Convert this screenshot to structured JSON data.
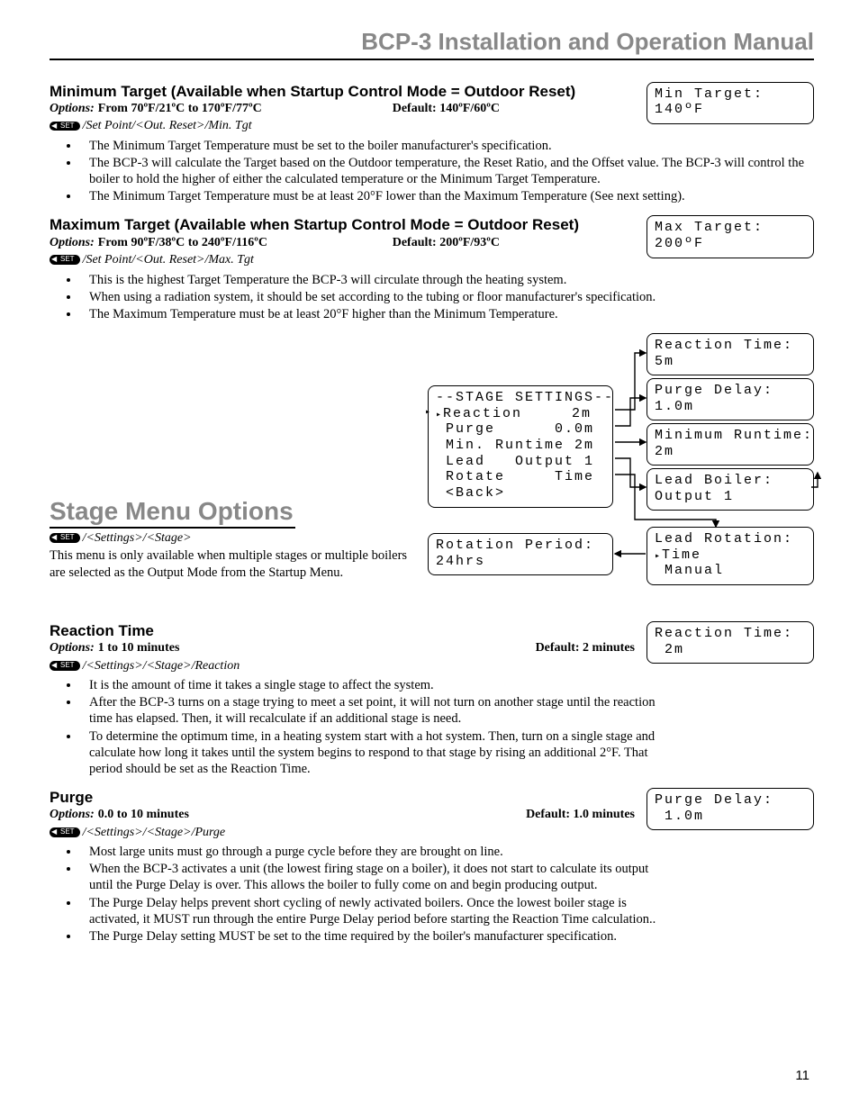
{
  "doc_title": "BCP-3 Installation and Operation Manual",
  "page_number": "11",
  "set_btn_label": "SET",
  "min_target_section": {
    "heading": "Minimum Target (Available when Startup Control Mode = Outdoor Reset)",
    "options_label": "Options:",
    "options_range": "From 70ºF/21ºC to 170ºF/77ºC",
    "default": "Default: 140ºF/60ºC",
    "path": "/Set Point/<Out. Reset>/Min. Tgt",
    "bullets": [
      "The Minimum Target Temperature must be set to the boiler manufacturer's specification.",
      "The BCP-3 will calculate the Target based on the Outdoor temperature, the Reset Ratio, and the Offset value.  The BCP-3 will control the boiler to hold the higher of either the calculated temperature or the Minimum Target Temperature.",
      "The Minimum Target Temperature must be at least 20°F lower than the Maximum Temperature (See next setting)."
    ],
    "lcd": {
      "l1": "Min Target:",
      "l2": "140ºF"
    }
  },
  "max_target_section": {
    "heading": "Maximum Target (Available when Startup Control Mode = Outdoor Reset)",
    "options_label": "Options:",
    "options_range": "From 90ºF/38ºC to 240ºF/116ºC",
    "default": "Default: 200ºF/93ºC",
    "path": "/Set Point/<Out. Reset>/Max. Tgt",
    "bullets": [
      "This is the highest Target Temperature the BCP-3 will circulate through the heating system.",
      "When using a radiation system, it should be set according to the tubing or floor manufacturer's specification.",
      "The Maximum Temperature must be at least 20°F higher than the Minimum Temperature."
    ],
    "lcd": {
      "l1": "Max Target:",
      "l2": "200ºF"
    }
  },
  "stage_menu": {
    "heading": "Stage Menu Options",
    "path": "/<Settings>/<Stage>",
    "intro": "This menu is only available when multiple stages or multiple boilers are selected as the Output Mode from the Startup Menu.",
    "settings_lcd": {
      "title": "--STAGE SETTINGS--",
      "l_reaction": "Reaction     2m",
      "l_purge": "Purge      0.0m",
      "l_minrun": "Min. Runtime 2m",
      "l_lead": "Lead   Output 1",
      "l_rotate": "Rotate     Time",
      "l_back": "<Back>"
    },
    "side_lcds": {
      "reaction": {
        "l1": "Reaction Time:",
        "l2": "5m"
      },
      "purge": {
        "l1": "Purge Delay:",
        "l2": "1.0m"
      },
      "minruntime": {
        "l1": "Minimum Runtime:",
        "l2": "2m"
      },
      "leadboiler": {
        "l1": "Lead Boiler:",
        "l2": "Output 1"
      },
      "leadrot": {
        "l1": "Lead Rotation:",
        "l2": "Time",
        "l3": "Manual"
      },
      "rotperiod": {
        "l1": "Rotation Period:",
        "l2": "24hrs"
      }
    }
  },
  "reaction_time_section": {
    "heading": "Reaction Time",
    "options_label": "Options:",
    "options_range": "1 to 10 minutes",
    "default": "Default: 2 minutes",
    "path": "/<Settings>/<Stage>/Reaction",
    "bullets": [
      "It is the amount of time it takes a single stage to affect the system.",
      "After the BCP-3 turns on a stage trying to meet a set point, it will not turn on another stage until the reaction time has elapsed.  Then, it will recalculate if an additional stage is need.",
      "To determine the optimum time, in a heating system start with a hot system.  Then, turn on a single stage and calculate how long it takes until the system begins to respond to that stage by rising an additional 2°F.  That period should be set as the Reaction Time."
    ],
    "lcd": {
      "l1": "Reaction Time:",
      "l2": " 2m"
    }
  },
  "purge_section": {
    "heading": "Purge",
    "options_label": "Options:",
    "options_range": "0.0 to 10 minutes",
    "default": "Default: 1.0 minutes",
    "path": "/<Settings>/<Stage>/Purge",
    "bullets": [
      "Most large units must go through a purge cycle before they are brought on line.",
      "When the BCP-3 activates a unit (the lowest firing stage on a boiler), it does not start to calculate its output until the Purge Delay is over. This allows the boiler to fully come on and begin producing output.",
      "The Purge Delay helps prevent short cycling of newly activated boilers.  Once the lowest boiler stage is activated, it MUST run through the entire Purge Delay period before starting the Reaction Time calculation..",
      "The Purge Delay setting MUST be set to the time required by the boiler's manufacturer specification."
    ],
    "lcd": {
      "l1": "Purge Delay:",
      "l2": " 1.0m"
    }
  }
}
